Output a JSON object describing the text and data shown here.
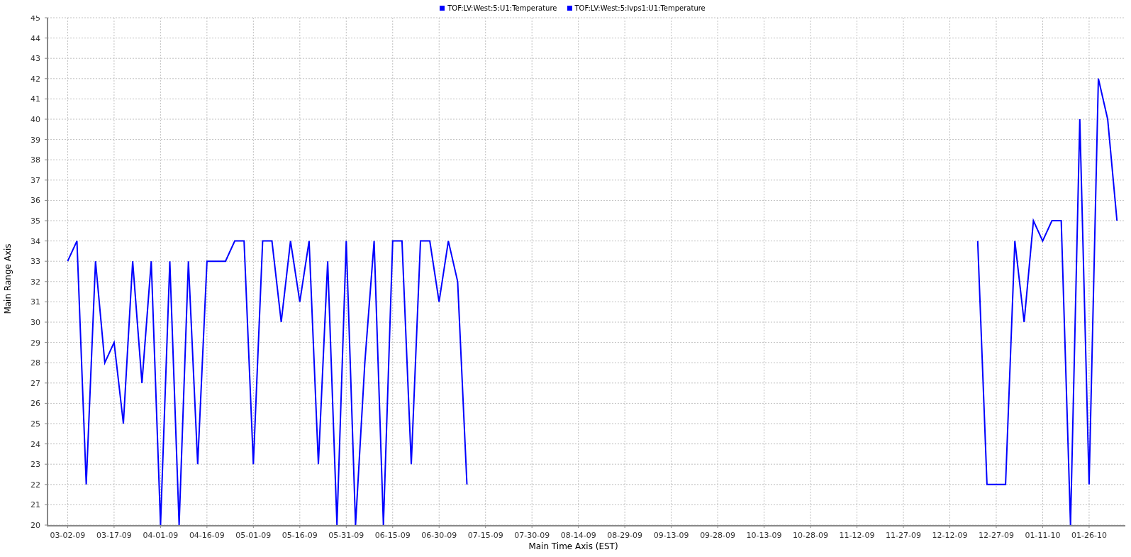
{
  "chart": {
    "chart_data": {
      "type": "line",
      "xlabel": "Main Time Axis (EST)",
      "ylabel": "Main Range Axis",
      "categories": [
        "03-02-09",
        null,
        null,
        null,
        null,
        "03-17-09",
        null,
        null,
        null,
        null,
        "04-01-09",
        null,
        null,
        null,
        null,
        "04-16-09",
        null,
        null,
        null,
        null,
        "05-01-09",
        null,
        null,
        null,
        null,
        "05-16-09",
        null,
        null,
        null,
        null,
        "05-31-09",
        null,
        null,
        null,
        null,
        "06-15-09",
        null,
        null,
        null,
        null,
        "06-30-09",
        null,
        null,
        null,
        null,
        "07-15-09",
        null,
        null,
        null,
        null,
        "07-30-09",
        null,
        null,
        null,
        null,
        "08-14-09",
        null,
        null,
        null,
        null,
        "08-29-09",
        null,
        null,
        null,
        null,
        "09-13-09",
        null,
        null,
        null,
        null,
        "09-28-09",
        null,
        null,
        null,
        null,
        "10-13-09",
        null,
        null,
        null,
        null,
        "10-28-09",
        null,
        null,
        null,
        null,
        "11-12-09",
        null,
        null,
        null,
        null,
        "11-27-09",
        null,
        null,
        null,
        null,
        "12-12-09",
        null,
        null,
        null,
        null,
        "12-27-09",
        null,
        null,
        null,
        null,
        "01-11-10",
        null,
        null,
        null,
        null,
        "01-26-10",
        null,
        null,
        null
      ],
      "series": [
        {
          "name": "TOF:LV:West:5:U1:Temperature",
          "color": "#0000ff",
          "values": [
            33,
            34,
            22,
            33,
            28,
            29,
            25,
            33,
            27,
            33,
            20,
            33,
            20,
            33,
            23,
            33,
            33,
            33,
            34,
            34,
            23,
            34,
            34,
            30,
            34,
            31,
            34,
            23,
            33,
            20,
            34,
            20,
            28,
            34,
            20,
            34,
            34,
            23,
            34,
            34,
            31,
            34,
            32,
            22,
            null,
            null,
            null,
            null,
            null,
            null,
            null,
            null,
            null,
            null,
            null,
            null,
            null,
            null,
            null,
            null,
            null,
            null,
            null,
            null,
            null,
            null,
            null,
            null,
            null,
            null,
            null,
            null,
            null,
            null,
            null,
            null,
            null,
            null,
            null,
            null,
            null,
            null,
            null,
            null,
            null,
            null,
            null,
            null,
            null,
            null,
            null,
            null,
            null,
            null,
            null,
            null,
            null,
            null,
            null,
            null,
            null,
            null,
            null,
            null,
            null,
            null,
            null,
            null,
            null,
            null,
            null,
            null,
            null,
            null
          ]
        },
        {
          "name": "TOF:LV:West:5:lvps1:U1:Temperature",
          "color": "#0000ff",
          "values": [
            null,
            null,
            null,
            null,
            null,
            null,
            null,
            null,
            null,
            null,
            null,
            null,
            null,
            null,
            null,
            null,
            null,
            null,
            null,
            null,
            null,
            null,
            null,
            null,
            null,
            null,
            null,
            null,
            null,
            null,
            null,
            null,
            null,
            null,
            null,
            null,
            null,
            null,
            null,
            null,
            null,
            null,
            null,
            null,
            null,
            null,
            null,
            null,
            null,
            null,
            null,
            null,
            null,
            null,
            null,
            null,
            null,
            null,
            null,
            null,
            null,
            null,
            null,
            null,
            null,
            null,
            null,
            null,
            null,
            null,
            null,
            null,
            null,
            null,
            null,
            null,
            null,
            null,
            null,
            null,
            null,
            null,
            null,
            null,
            null,
            null,
            null,
            null,
            null,
            null,
            null,
            null,
            null,
            null,
            null,
            null,
            null,
            null,
            34,
            22,
            22,
            22,
            34,
            30,
            35,
            34,
            35,
            35,
            20,
            40,
            22,
            42,
            40,
            35
          ]
        }
      ],
      "grid": true,
      "ylim": [
        20,
        45
      ],
      "yticks": [
        20,
        21,
        22,
        23,
        24,
        25,
        26,
        27,
        28,
        29,
        30,
        31,
        32,
        33,
        34,
        35,
        36,
        37,
        38,
        39,
        40,
        41,
        42,
        43,
        44,
        45
      ]
    }
  }
}
